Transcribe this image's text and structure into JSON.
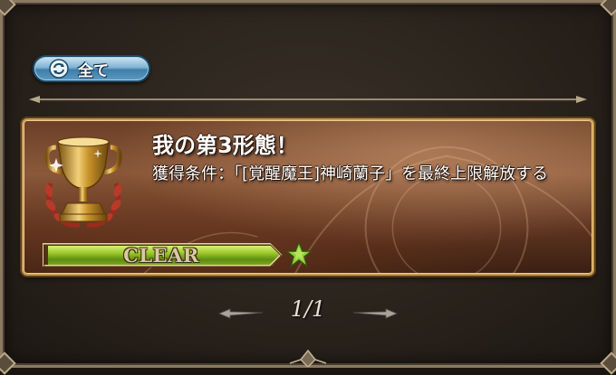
{
  "filter": {
    "label": "全て",
    "icon": "refresh-icon"
  },
  "achievement": {
    "title": "我の第3形態！",
    "condition": "獲得条件：「[覚醒魔王]神崎蘭子」を最終上限解放する",
    "status_label": "CLEAR",
    "progress": 1.0,
    "icon": "trophy-icon",
    "reward_icon": "star-icon"
  },
  "pager": {
    "text": "1/1"
  },
  "colors": {
    "button_blue": "#5c9ac2",
    "card_gold_border": "#c79b54",
    "progress_green": "#9fcb2c",
    "star_green": "#8fd13a"
  }
}
